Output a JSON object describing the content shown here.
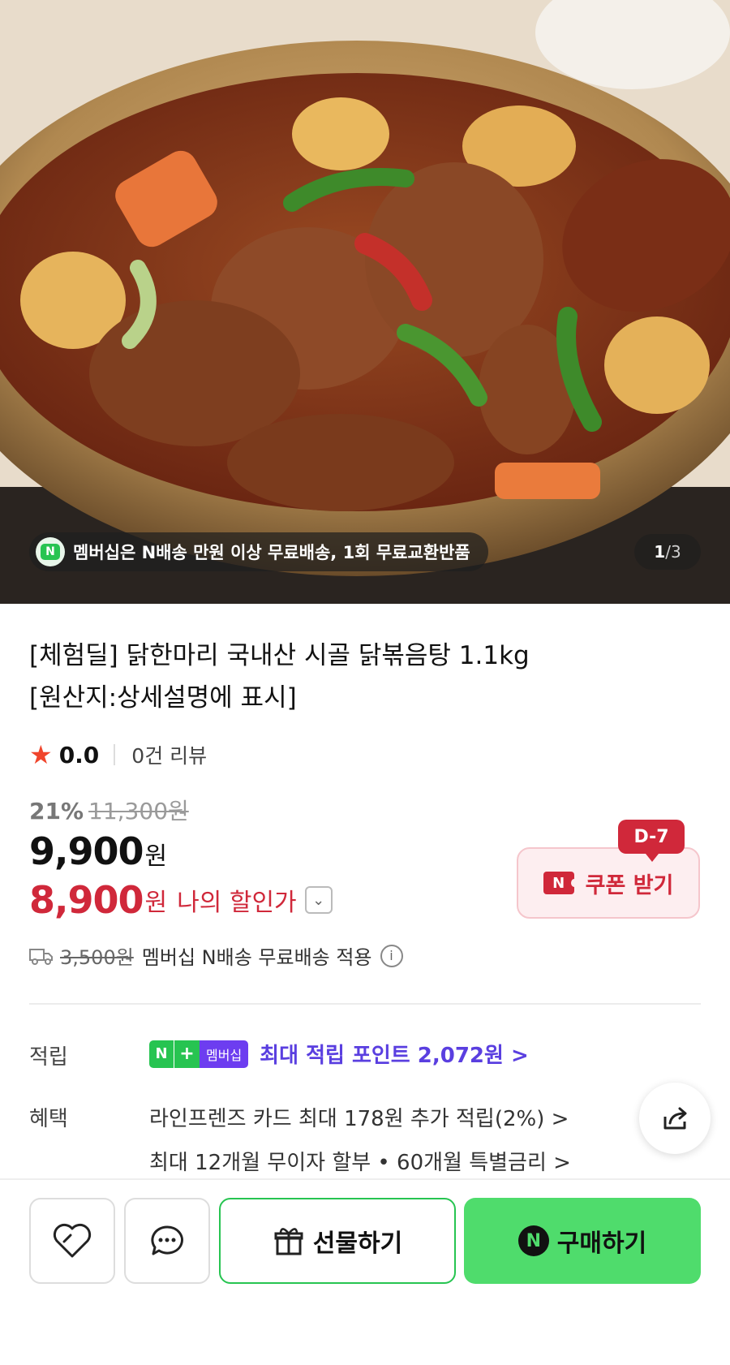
{
  "hero": {
    "banner_text": "멤버십은 N배송 만원 이상 무료배송, 1회 무료교환반품",
    "n_badge": "N",
    "counter": {
      "current": "1",
      "separator": "/",
      "total": "3"
    }
  },
  "product": {
    "title_line1": "[체험딜] 닭한마리 국내산 시골 닭볶음탕 1.1kg",
    "title_line2": "[원산지:상세설명에 표시]",
    "rating": {
      "star": "★",
      "score": "0.0",
      "reviews": "0건 리뷰"
    },
    "discount_percent": "21%",
    "original_price": "11,300원",
    "price": {
      "number": "9,900",
      "unit": "원"
    },
    "my_price": {
      "number": "8,900",
      "unit": "원",
      "label": "나의 할인가",
      "chevron": "⌄"
    },
    "coupon": {
      "badge": "D-7",
      "icon": "N",
      "label": "쿠폰 받기"
    },
    "shipping": {
      "old_fee": "3,500원",
      "text": "멤버십 N배송 무료배송 적용",
      "info": "i"
    }
  },
  "details": {
    "points_label": "적립",
    "points_chip": {
      "n": "N",
      "plus": "+",
      "member": "멤버십"
    },
    "points_text": "최대 적립 포인트 2,072원 >",
    "benefits_label": "혜택",
    "benefit_1": "라인프렌즈 카드 최대 178원 추가 적립(2%) >",
    "benefit_2": "최대 12개월 무이자 할부 • 60개월 특별금리 >"
  },
  "actions": {
    "gift_label": "선물하기",
    "buy_icon": "N",
    "buy_label": "구매하기"
  },
  "colors": {
    "accent_green": "#4fdc6c",
    "naver_green": "#27c451",
    "discount_red": "#d0283a",
    "points_purple": "#5a3fe0",
    "star": "#f0452c"
  }
}
